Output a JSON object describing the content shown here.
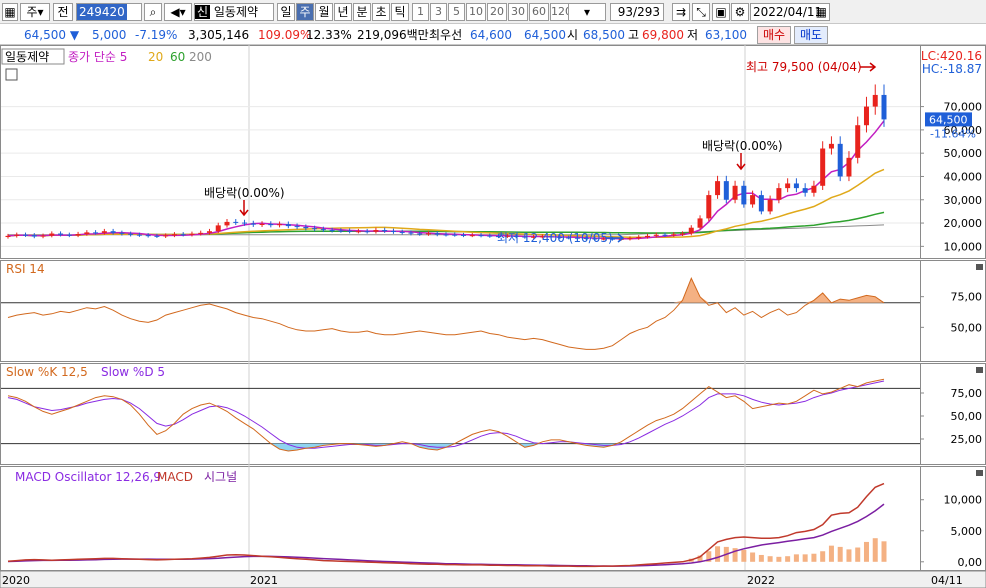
{
  "toolbar": {
    "market": "주",
    "mode": "전",
    "code": "249420",
    "sin_badge": "신",
    "stock_name": "일동제약",
    "periods": [
      "일",
      "주",
      "월",
      "년",
      "분",
      "초",
      "틱"
    ],
    "active_period": "주",
    "intervals": [
      "1",
      "3",
      "5",
      "10",
      "20",
      "30",
      "60",
      "120"
    ],
    "page_count": "93/293",
    "date": "2022/04/11"
  },
  "info": {
    "price": "64,500",
    "change": "5,000",
    "change_pct": "-7.19%",
    "volume": "3,305,146",
    "vol_ratio": "109.09%",
    "turnover": "12.33%",
    "trade_value": "219,096백만",
    "priority_label": "최우선",
    "priority_ask": "64,600",
    "priority_bid": "64,500",
    "open_label": "시",
    "open": "68,500",
    "high_label": "고",
    "high": "69,800",
    "low_label": "저",
    "low": "63,100",
    "buy": "매수",
    "sell": "매도"
  },
  "colors": {
    "up": "#e8231d",
    "down": "#1f5fd8",
    "ma5": "#c21ec2",
    "ma20": "#e0a91a",
    "ma60": "#2ea12e",
    "ma200": "#8a8a8a",
    "rsi": "#d2691e",
    "slowk": "#d2691e",
    "slowd": "#8a2be2",
    "macd": "#c0392b",
    "signal": "#7b1fa2",
    "osc": "#f4b183"
  },
  "chart_data": [
    {
      "type": "candlestick",
      "legend": {
        "name": "일동제약",
        "ma_label": "종가 단순",
        "ma_periods": [
          "5",
          "20",
          "60",
          "200"
        ]
      },
      "ylim": [
        5000,
        90000
      ],
      "y_ticks": [
        "70,000",
        "60,000",
        "50,000",
        "40,000",
        "30,000",
        "20,000",
        "10,000"
      ],
      "current_price": "64,500",
      "current_pct": "-11.64%",
      "lc_label": "LC:420.16",
      "hc_label": "HC:-18.87",
      "annotations": {
        "high": "최고 79,500 (04/04)",
        "low": "최저 12,400 (10/05)",
        "dividend1": "배당락(0.00%)",
        "dividend2": "배당락(0.00%)"
      },
      "x_labels": [
        "2020",
        "2021",
        "2022",
        "04/11"
      ],
      "candles_o": [
        14000,
        14500,
        15000,
        14800,
        14200,
        14600,
        15500,
        15000,
        14700,
        15300,
        16000,
        15800,
        16500,
        15800,
        15400,
        15000,
        14800,
        14500,
        14300,
        14700,
        15200,
        15000,
        15400,
        15800,
        16500,
        19000,
        20500,
        20200,
        19800,
        19300,
        19600,
        19100,
        19500,
        18700,
        18300,
        17800,
        17400,
        17000,
        16800,
        16700,
        16400,
        16500,
        16300,
        17000,
        16600,
        16200,
        15900,
        15500,
        15300,
        15600,
        15100,
        15000,
        14900,
        14700,
        14800,
        14600,
        14400,
        14300,
        14500,
        14200,
        14000,
        14100,
        14300,
        14000,
        13800,
        13700,
        13600,
        13400,
        13200,
        13300,
        13100,
        13200,
        13500,
        14000,
        14500,
        15000,
        14800,
        15200,
        15500,
        18000,
        22000,
        32000,
        38000,
        30000,
        36000,
        28000,
        32000,
        25000,
        30000,
        35000,
        37000,
        35000,
        33000,
        36000,
        52000,
        54000,
        40000,
        48000,
        62000,
        70000,
        75000
      ],
      "candles_c": [
        14500,
        15000,
        14800,
        14200,
        14600,
        15500,
        15000,
        14700,
        15300,
        16000,
        15800,
        16500,
        15800,
        15400,
        15000,
        14800,
        14500,
        14300,
        14700,
        15200,
        15000,
        15400,
        15800,
        16500,
        19000,
        20500,
        20200,
        19800,
        19300,
        19600,
        19100,
        19500,
        18700,
        18300,
        17800,
        17400,
        17000,
        16800,
        16700,
        16400,
        16500,
        16300,
        17000,
        16600,
        16200,
        15900,
        15500,
        15300,
        15600,
        15100,
        15000,
        14900,
        14700,
        14800,
        14600,
        14400,
        14300,
        14500,
        14200,
        14000,
        14100,
        14300,
        14000,
        13800,
        13700,
        13600,
        13400,
        13200,
        13300,
        13100,
        13200,
        13500,
        14000,
        14500,
        15000,
        14800,
        15200,
        15500,
        18000,
        22000,
        32000,
        38000,
        30000,
        36000,
        28000,
        32000,
        25000,
        30000,
        35000,
        37000,
        35000,
        33000,
        36000,
        52000,
        54000,
        40000,
        48000,
        62000,
        70000,
        75000,
        64500
      ]
    },
    {
      "type": "line",
      "title": "RSI 14",
      "ylim": [
        25,
        100
      ],
      "y_ticks": [
        "75,00",
        "50,00"
      ],
      "threshold": 70,
      "values": [
        58,
        60,
        61,
        62,
        60,
        61,
        63,
        62,
        64,
        66,
        65,
        67,
        64,
        60,
        57,
        55,
        54,
        56,
        60,
        62,
        64,
        66,
        68,
        69,
        67,
        65,
        62,
        60,
        58,
        57,
        55,
        53,
        50,
        48,
        47,
        47,
        48,
        49,
        47,
        46,
        46,
        47,
        45,
        44,
        44,
        45,
        46,
        47,
        46,
        45,
        44,
        44,
        45,
        46,
        47,
        45,
        44,
        42,
        41,
        40,
        41,
        40,
        38,
        36,
        34,
        33,
        32,
        32,
        33,
        35,
        40,
        45,
        48,
        50,
        55,
        58,
        64,
        72,
        90,
        75,
        68,
        70,
        62,
        66,
        60,
        63,
        58,
        62,
        65,
        60,
        62,
        68,
        72,
        78,
        70,
        73,
        72,
        74,
        76,
        75,
        70
      ]
    },
    {
      "type": "line",
      "title": "Slow %K 12,5",
      "title2": "Slow %D 5",
      "ylim": [
        0,
        100
      ],
      "y_ticks": [
        "75,00",
        "50,00",
        "25,00"
      ],
      "threshold_low": 20,
      "series_k": [
        72,
        70,
        66,
        60,
        55,
        52,
        55,
        58,
        62,
        66,
        70,
        72,
        71,
        68,
        62,
        52,
        40,
        30,
        34,
        42,
        52,
        58,
        62,
        64,
        60,
        55,
        48,
        42,
        36,
        28,
        20,
        14,
        12,
        13,
        15,
        16,
        18,
        19,
        20,
        20,
        19,
        18,
        17,
        18,
        20,
        22,
        20,
        16,
        14,
        13,
        16,
        20,
        25,
        30,
        33,
        35,
        33,
        28,
        22,
        16,
        18,
        22,
        24,
        24,
        22,
        20,
        18,
        17,
        16,
        18,
        22,
        28,
        34,
        40,
        45,
        48,
        52,
        58,
        66,
        74,
        82,
        76,
        70,
        72,
        66,
        58,
        60,
        62,
        64,
        63,
        66,
        72,
        78,
        74,
        76,
        80,
        84,
        82,
        86,
        88,
        90
      ],
      "series_d": [
        70,
        68,
        64,
        60,
        58,
        56,
        57,
        59,
        61,
        64,
        66,
        68,
        69,
        68,
        64,
        58,
        50,
        42,
        39,
        41,
        46,
        52,
        56,
        60,
        61,
        59,
        55,
        50,
        44,
        38,
        31,
        24,
        19,
        16,
        15,
        15,
        16,
        17,
        18,
        19,
        19,
        19,
        18,
        18,
        19,
        20,
        20,
        19,
        17,
        16,
        16,
        17,
        20,
        24,
        28,
        31,
        32,
        31,
        28,
        24,
        21,
        20,
        21,
        22,
        22,
        21,
        20,
        19,
        18,
        18,
        19,
        22,
        26,
        31,
        36,
        41,
        45,
        50,
        56,
        62,
        70,
        74,
        74,
        74,
        72,
        68,
        65,
        63,
        62,
        63,
        64,
        66,
        70,
        73,
        75,
        78,
        80,
        82,
        84,
        86,
        88
      ]
    },
    {
      "type": "bar",
      "title": "MACD Oscillator 12,26,9",
      "title2": "MACD",
      "title3": "시그널",
      "ylim": [
        -1000,
        13500
      ],
      "y_ticks": [
        "10,000",
        "5,000",
        "0,00"
      ],
      "macd": [
        100,
        200,
        300,
        350,
        300,
        250,
        300,
        350,
        400,
        450,
        500,
        550,
        550,
        500,
        450,
        400,
        350,
        300,
        350,
        400,
        450,
        500,
        600,
        700,
        900,
        1100,
        1150,
        1100,
        1000,
        900,
        800,
        700,
        600,
        500,
        400,
        300,
        200,
        150,
        100,
        50,
        0,
        -50,
        -100,
        -150,
        -200,
        -250,
        -300,
        -350,
        -400,
        -400,
        -450,
        -450,
        -500,
        -500,
        -500,
        -550,
        -550,
        -600,
        -600,
        -650,
        -650,
        -650,
        -700,
        -700,
        -700,
        -750,
        -750,
        -750,
        -700,
        -700,
        -650,
        -600,
        -500,
        -400,
        -300,
        -200,
        -100,
        0,
        300,
        800,
        2000,
        3200,
        3600,
        3900,
        4000,
        3900,
        3800,
        3800,
        3900,
        4200,
        4700,
        4900,
        5200,
        6000,
        7500,
        7800,
        7900,
        8800,
        10500,
        12000,
        12600
      ],
      "signal": [
        50,
        100,
        150,
        200,
        220,
        230,
        240,
        260,
        280,
        310,
        340,
        380,
        410,
        430,
        440,
        440,
        430,
        410,
        400,
        400,
        410,
        430,
        460,
        510,
        580,
        670,
        760,
        830,
        870,
        880,
        870,
        840,
        790,
        730,
        670,
        600,
        520,
        450,
        380,
        310,
        240,
        170,
        110,
        50,
        0,
        -50,
        -100,
        -150,
        -200,
        -250,
        -300,
        -330,
        -360,
        -390,
        -410,
        -430,
        -450,
        -470,
        -490,
        -510,
        -530,
        -550,
        -570,
        -590,
        -610,
        -630,
        -650,
        -670,
        -680,
        -690,
        -690,
        -680,
        -650,
        -600,
        -540,
        -470,
        -400,
        -320,
        -200,
        0,
        300,
        700,
        1200,
        1700,
        2100,
        2400,
        2700,
        2900,
        3100,
        3300,
        3500,
        3700,
        3900,
        4300,
        4900,
        5400,
        5900,
        6500,
        7300,
        8200,
        9300
      ],
      "oscillator": [
        0,
        0,
        0,
        0,
        0,
        0,
        0,
        0,
        0,
        0,
        0,
        0,
        0,
        0,
        0,
        0,
        0,
        0,
        0,
        0,
        0,
        0,
        0,
        0,
        0,
        0,
        0,
        0,
        0,
        0,
        0,
        0,
        0,
        0,
        0,
        0,
        0,
        0,
        0,
        0,
        0,
        0,
        0,
        0,
        0,
        0,
        0,
        0,
        0,
        0,
        0,
        0,
        0,
        0,
        0,
        0,
        0,
        0,
        0,
        0,
        0,
        0,
        0,
        0,
        0,
        0,
        0,
        0,
        0,
        0,
        0,
        0,
        0,
        0,
        0,
        0,
        0,
        0,
        500,
        1000,
        1700,
        2500,
        2400,
        2200,
        1900,
        1500,
        1100,
        900,
        800,
        900,
        1200,
        1200,
        1300,
        1700,
        2600,
        2400,
        2000,
        2300,
        3200,
        3800,
        3300
      ]
    }
  ]
}
